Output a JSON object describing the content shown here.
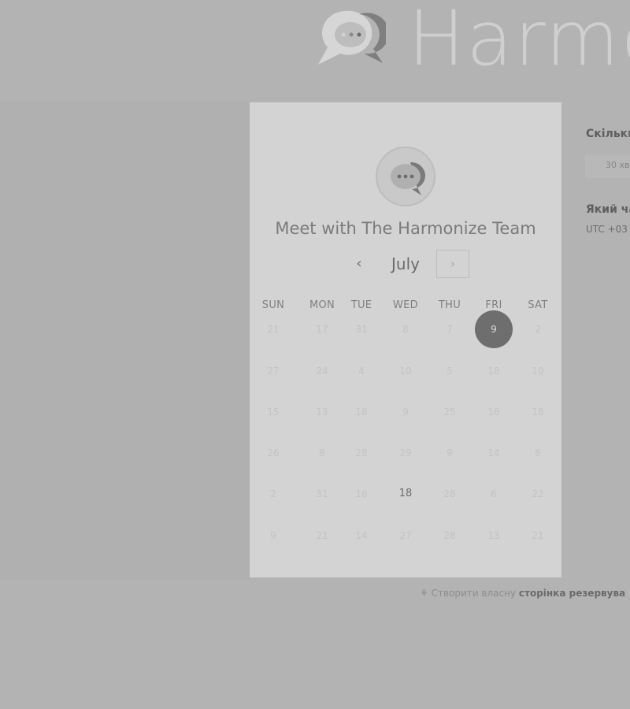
{
  "brand": {
    "name": "Harmo",
    "logo_icon": "chat-bubbles-icon"
  },
  "card": {
    "avatar_icon": "chat-bubbles-icon",
    "title": "Meet with The Harmonize Team",
    "month": "July",
    "prev_icon": "‹",
    "next_icon": "›",
    "weekdays": [
      "SUN",
      "MON",
      "TUE",
      "WED",
      "THU",
      "FRI",
      "SAT"
    ],
    "weeks": [
      [
        "21",
        "17",
        "31",
        "8",
        "7",
        "9",
        "2"
      ],
      [
        "27",
        "24",
        "4",
        "10",
        "5",
        "18",
        "10"
      ],
      [
        "15",
        "13",
        "18",
        "9",
        "25",
        "18",
        "18"
      ],
      [
        "26",
        "8",
        "28",
        "29",
        "9",
        "14",
        "6"
      ],
      [
        "2",
        "31",
        "16",
        "18",
        "28",
        "6",
        "22"
      ],
      [
        "9",
        "21",
        "14",
        "27",
        "28",
        "13",
        "21"
      ]
    ],
    "available_days": [
      "18"
    ],
    "selected_day": "9"
  },
  "side_panel": {
    "duration_label": "Скільки",
    "duration_value": "30 хв",
    "time_label": "Який ча",
    "timezone": "UTC +03"
  },
  "footer": {
    "icon": "sparkle-icon",
    "text": "Створити власну",
    "link": "сторінка резервува"
  },
  "colors": {
    "selected": "#6e6e6e",
    "card": "#d3d3d3",
    "overlay": "#b3b3b3"
  }
}
